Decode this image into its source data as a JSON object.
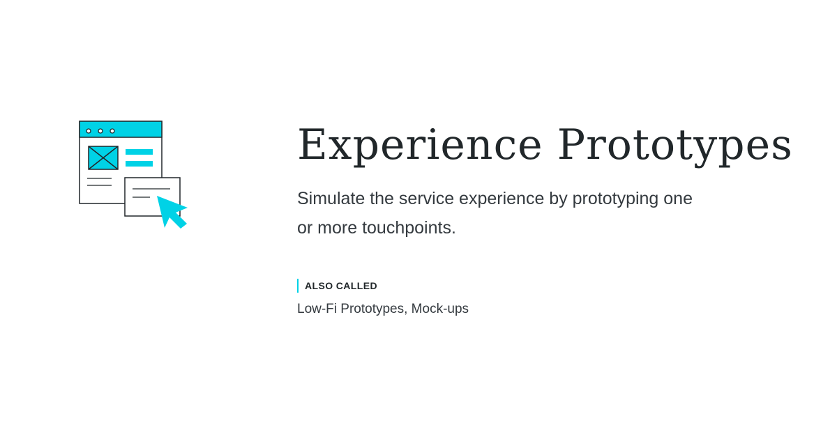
{
  "illustration": {
    "icon": "prototype-wireframe-cursor-icon",
    "accent_color": "#00d2e6",
    "stroke_color": "#21272a"
  },
  "header": {
    "title": "Experience Prototypes"
  },
  "main": {
    "description": "Simulate the service experience by prototyping one or more touchpoints.",
    "also_called": {
      "label": "ALSO CALLED",
      "value": "Low-Fi Prototypes, Mock-ups"
    }
  },
  "colors": {
    "background": "#ffffff",
    "text": "#21272a",
    "accent": "#00d2e6"
  }
}
